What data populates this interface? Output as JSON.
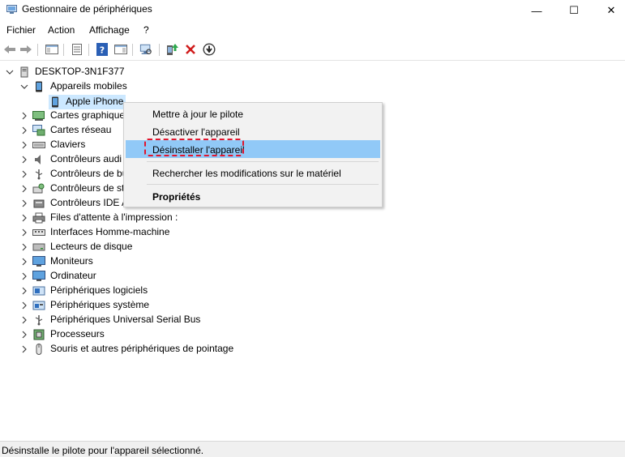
{
  "window": {
    "title": "Gestionnaire de périphériques",
    "minimize_glyph": "—",
    "maximize_glyph": "☐",
    "close_glyph": "✕"
  },
  "menu": {
    "items": [
      "Fichier",
      "Action",
      "Affichage",
      "?"
    ]
  },
  "toolbar": {
    "buttons": [
      "back-icon",
      "forward-icon",
      "show-hide-console-tree-icon",
      "properties-icon",
      "help-icon",
      "show-action-pane-icon",
      "scan-hardware-icon",
      "update-driver-icon",
      "uninstall-icon",
      "disable-icon"
    ]
  },
  "tree": {
    "root": "DESKTOP-3N1F377",
    "expanded_category": "Appareils mobiles",
    "selected_device": "Apple iPhone",
    "categories": [
      "Cartes graphiques",
      "Cartes réseau",
      "Claviers",
      "Contrôleurs audio, vidéo et jeu",
      "Contrôleurs de bus USB",
      "Contrôleurs de stockage",
      "Contrôleurs IDE ATA/ATAPI",
      "Files d'attente à l'impression :",
      "Interfaces Homme-machine",
      "Lecteurs de disque",
      "Moniteurs",
      "Ordinateur",
      "Périphériques logiciels",
      "Périphériques système",
      "Périphériques Universal Serial Bus",
      "Processeurs",
      "Souris et autres périphériques de pointage"
    ],
    "visible_labels": [
      "Cartes graphiques",
      "Cartes réseau",
      "Claviers",
      "Contrôleurs audi",
      "Contrôleurs de bu",
      "Contrôleurs de st",
      "Contrôleurs IDE A",
      "Files d'attente à l'impression :",
      "Interfaces Homme-machine",
      "Lecteurs de disque",
      "Moniteurs",
      "Ordinateur",
      "Périphériques logiciels",
      "Périphériques système",
      "Périphériques Universal Serial Bus",
      "Processeurs",
      "Souris et autres périphériques de pointage"
    ]
  },
  "context_menu": {
    "update_driver": "Mettre à jour le pilote",
    "disable_device": "Désactiver l'appareil",
    "uninstall_device": "Désinstaller l'appareil",
    "scan_hardware": "Rechercher les modifications sur le matériel",
    "properties": "Propriétés"
  },
  "status_bar": {
    "text": "Désinstalle le pilote pour l'appareil sélectionné."
  },
  "colors": {
    "selection": "#cce8ff",
    "menu_highlight": "#91c9f7",
    "annotation_red": "#e1152d"
  }
}
